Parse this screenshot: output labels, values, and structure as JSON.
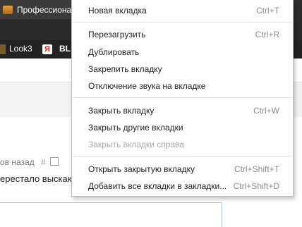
{
  "background": {
    "tab_title": "Профессиона",
    "bookmarks": {
      "look3": "Look3",
      "yandex_glyph": "Я",
      "truncated": "BL"
    },
    "page_time": "ов назад",
    "page_hash": "#",
    "page_text": "ерестало выскак"
  },
  "context_menu": {
    "items": [
      {
        "label": "Новая вкладка",
        "shortcut": "Ctrl+T",
        "enabled": true
      },
      {
        "label": "Перезагрузить",
        "shortcut": "Ctrl+R",
        "enabled": true
      },
      {
        "label": "Дублировать",
        "shortcut": "",
        "enabled": true
      },
      {
        "label": "Закрепить вкладку",
        "shortcut": "",
        "enabled": true
      },
      {
        "label": "Отключение звука на вкладке",
        "shortcut": "",
        "enabled": true
      },
      {
        "label": "Закрыть вкладку",
        "shortcut": "Ctrl+W",
        "enabled": true
      },
      {
        "label": "Закрыть другие вкладки",
        "shortcut": "",
        "enabled": true
      },
      {
        "label": "Закрыть вкладки справа",
        "shortcut": "",
        "enabled": false
      },
      {
        "label": "Открыть закрытую вкладку",
        "shortcut": "Ctrl+Shift+T",
        "enabled": true
      },
      {
        "label": "Добавить все вкладки в закладки...",
        "shortcut": "Ctrl+Shift+D",
        "enabled": true
      }
    ]
  }
}
